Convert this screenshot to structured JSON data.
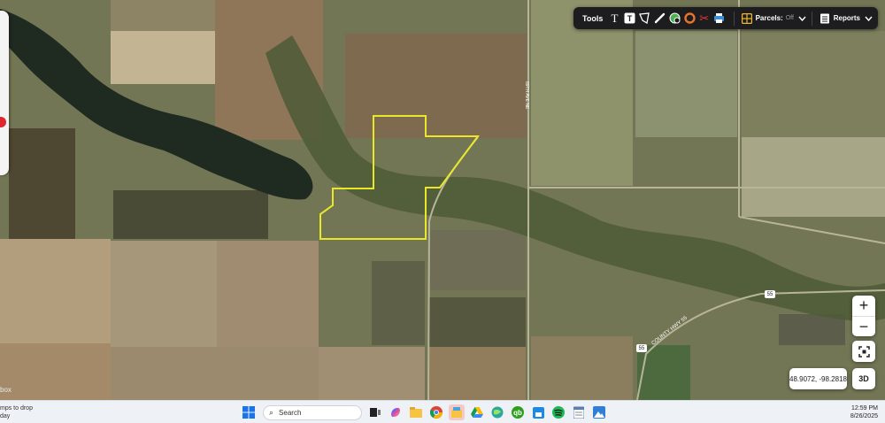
{
  "map": {
    "road_labels": [
      {
        "id": "county-road-label",
        "text": "COUNTY HWY 55"
      },
      {
        "id": "road-shield-1",
        "text": "55"
      },
      {
        "id": "road-shield-2",
        "text": "55"
      },
      {
        "id": "avenue-label",
        "text": "89TH AVE NE"
      }
    ],
    "parcel_outline_color": "#e8e829",
    "attribution": "box",
    "side_badge_color": "#e0262e"
  },
  "toolbar": {
    "tools_label": "Tools",
    "icons": [
      "text-icon",
      "text-box-icon",
      "polygon-icon",
      "pencil-icon",
      "globe-icon",
      "ring-icon",
      "scissors-icon",
      "print-icon"
    ],
    "parcels_label": "Parcels:",
    "parcels_state": "Off",
    "reports_label": "Reports"
  },
  "controls": {
    "zoom_in": "+",
    "zoom_out": "−",
    "coordinates": "48.9072, -98.2818",
    "three_d": "3D"
  },
  "taskbar": {
    "weather_line1": "mps to drop",
    "weather_line2": "day",
    "search_placeholder": "Search",
    "time": "12:59 PM",
    "date": "8/26/2025"
  }
}
